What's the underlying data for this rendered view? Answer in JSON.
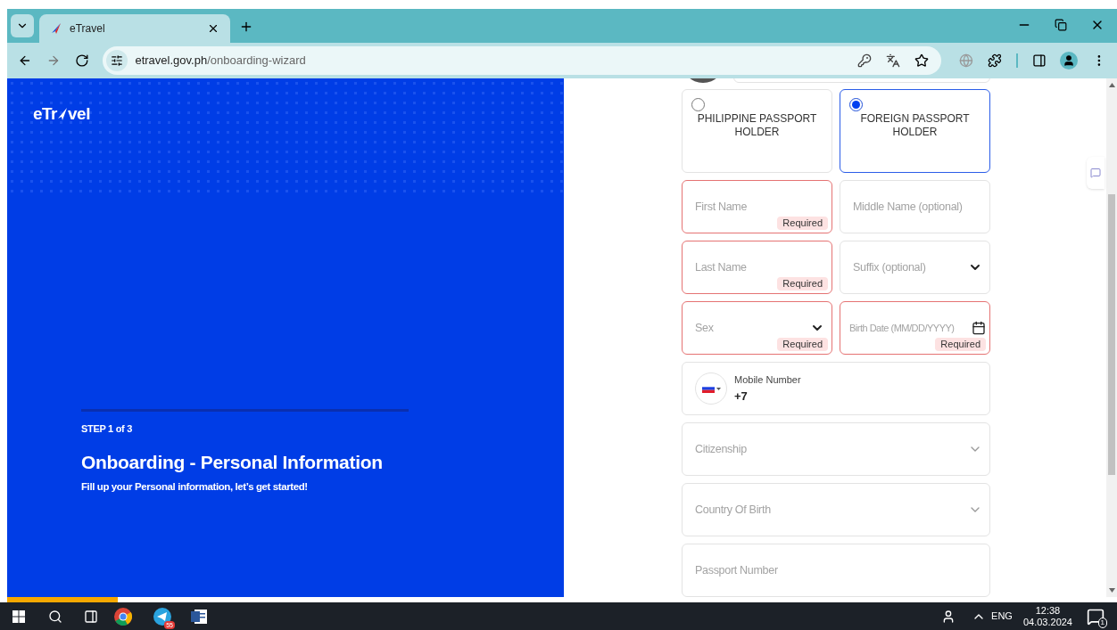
{
  "browser": {
    "tab": {
      "title": "eTravel"
    },
    "url": {
      "host": "etravel.gov.ph",
      "path": "/onboarding-wizard"
    }
  },
  "hero": {
    "logo": {
      "before": "eTr",
      "after": "vel"
    },
    "step": "STEP 1 of 3",
    "title": "Onboarding - Personal Information",
    "subtitle": "Fill up your Personal information, let’s get started!"
  },
  "passport_types": [
    {
      "label": "PHILIPPINE PASSPORT HOLDER",
      "selected": false
    },
    {
      "label": "FOREIGN PASSPORT HOLDER",
      "selected": true
    }
  ],
  "name_fields": [
    {
      "kind": "text",
      "placeholder": "First Name",
      "error": true,
      "badge": "Required"
    },
    {
      "kind": "text",
      "placeholder": "Middle Name (optional)",
      "error": false
    },
    {
      "kind": "text",
      "placeholder": "Last Name",
      "error": true,
      "badge": "Required"
    },
    {
      "kind": "select",
      "placeholder": "Suffix (optional)",
      "error": false
    },
    {
      "kind": "select",
      "placeholder": "Sex",
      "error": true,
      "badge": "Required"
    },
    {
      "kind": "date",
      "placeholder": "Birth Date (MM/DD/YYYY)",
      "error": true,
      "badge": "Required"
    }
  ],
  "mobile": {
    "label": "Mobile Number",
    "value": "+7"
  },
  "detail_fields": [
    {
      "kind": "select",
      "placeholder": "Citizenship"
    },
    {
      "kind": "select",
      "placeholder": "Country Of Birth"
    },
    {
      "kind": "text",
      "placeholder": "Passport Number"
    }
  ],
  "page_progress": {
    "level": 0.1
  },
  "taskbar": {
    "telegram_badge": "55",
    "language": "ENG",
    "time": "12:38",
    "date": "04.03.2024",
    "notification_count": "1"
  }
}
